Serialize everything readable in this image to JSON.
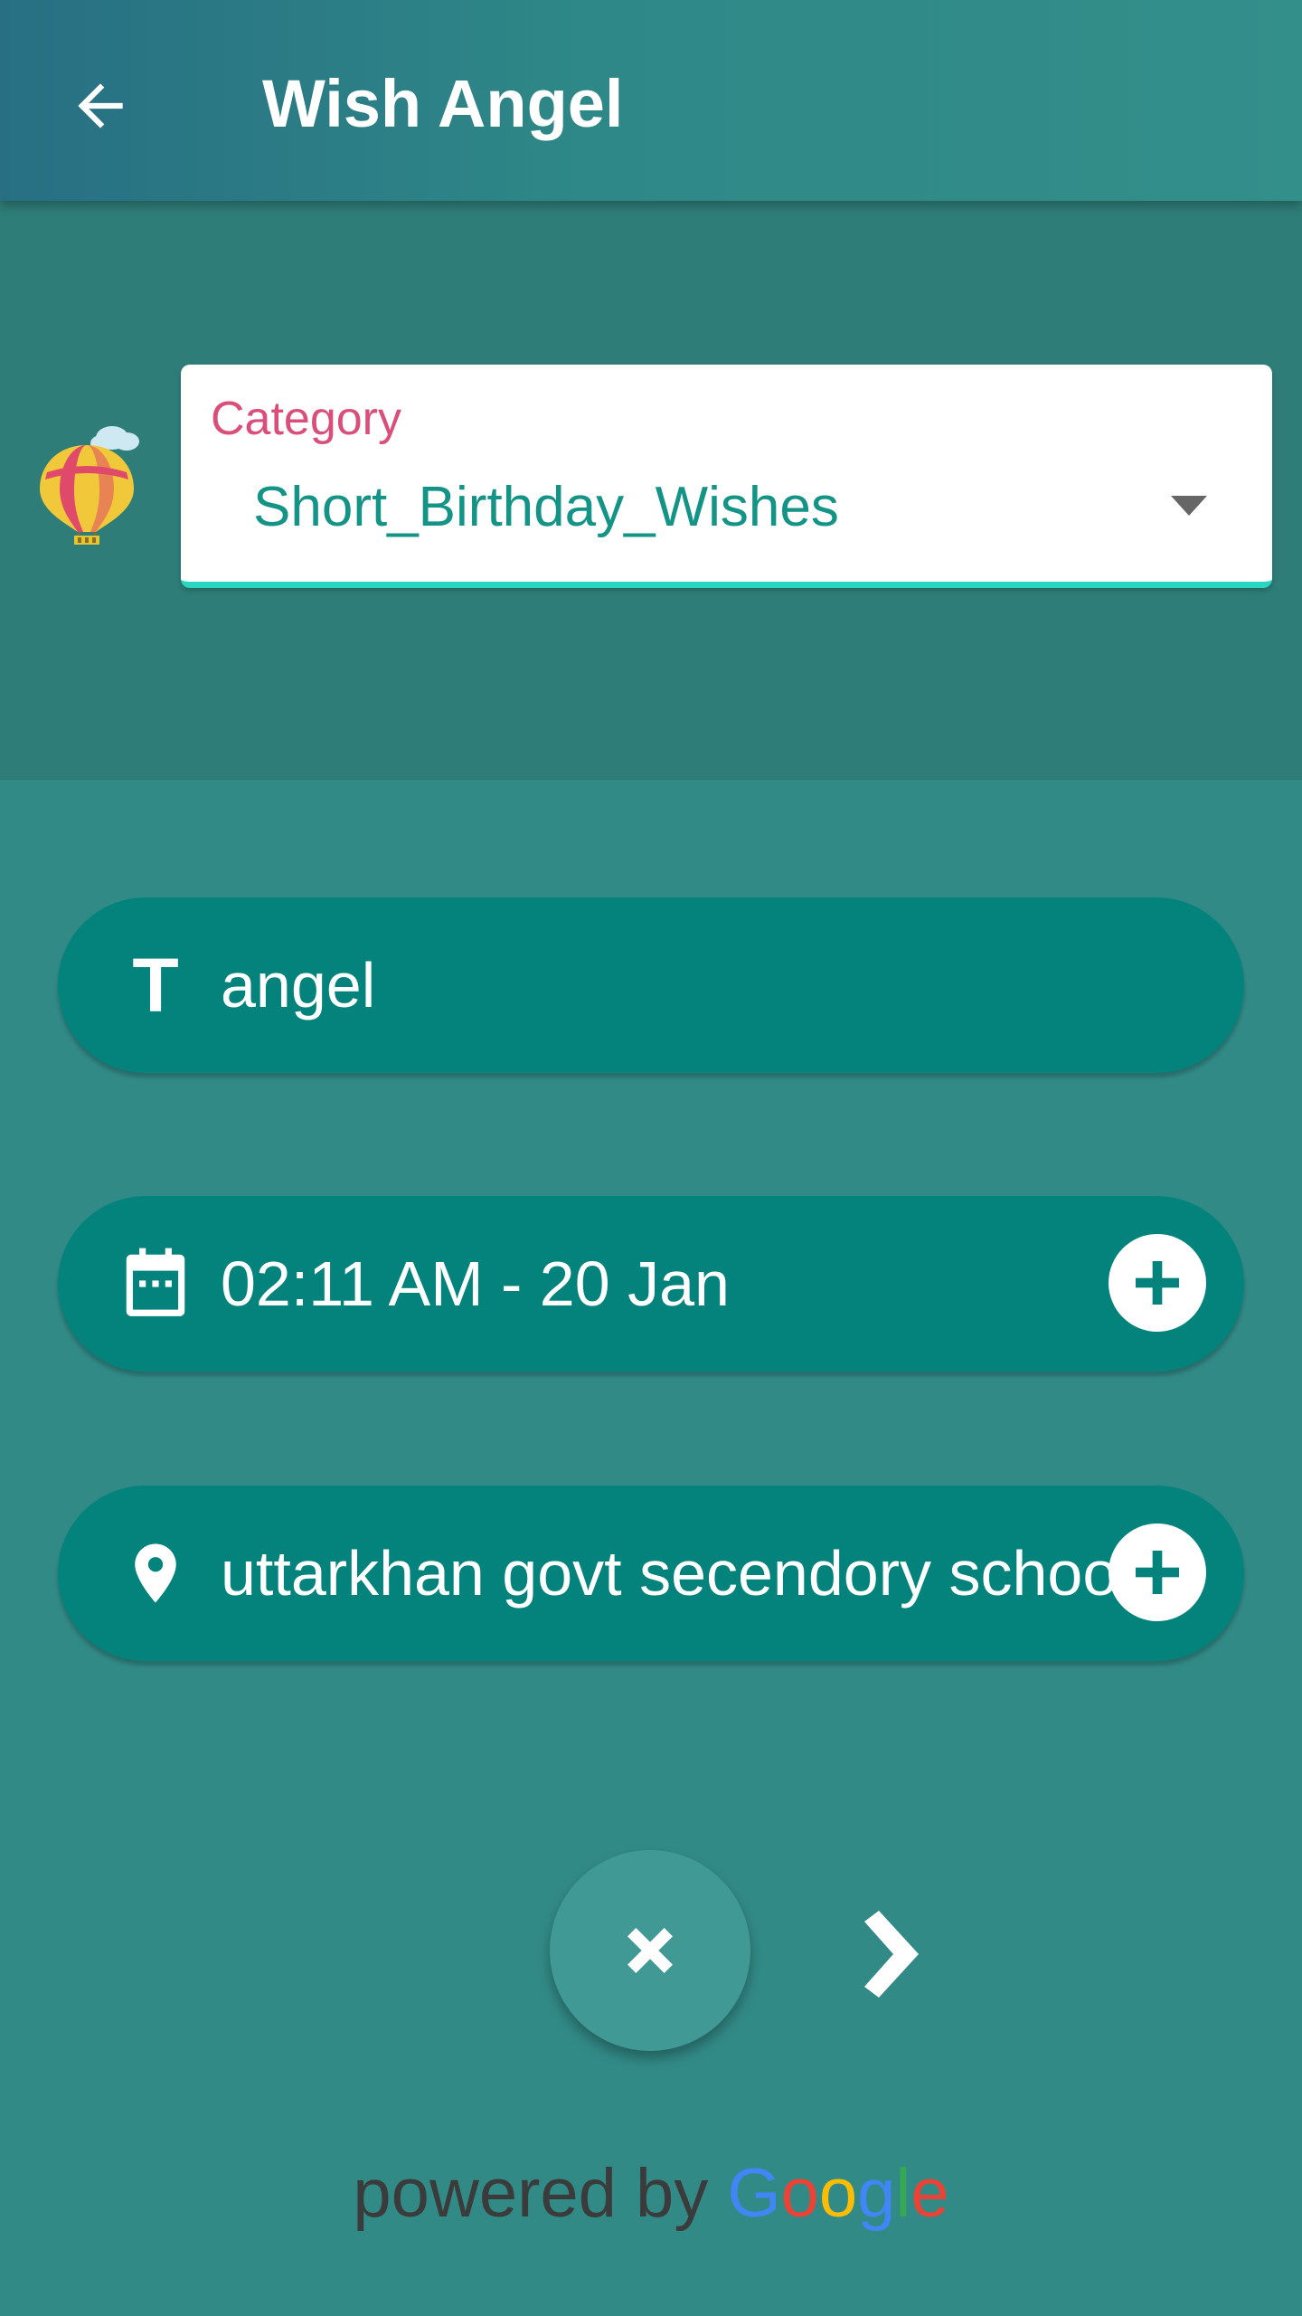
{
  "app_bar": {
    "title": "Wish Angel",
    "back_icon": "arrow-left-icon"
  },
  "category": {
    "label": "Category",
    "value": "Short_Birthday_Wishes",
    "dropdown_icon": "caret-down-icon",
    "logo_icon": "hot-air-balloon-icon"
  },
  "fields": {
    "title": {
      "icon": "text-icon",
      "icon_glyph": "T",
      "value": "angel"
    },
    "datetime": {
      "icon": "calendar-icon",
      "value": "02:11 AM - 20 Jan",
      "action_icon": "plus-icon"
    },
    "location": {
      "icon": "location-pin-icon",
      "value": "uttarkhan govt secendory school",
      "action_icon": "plus-icon"
    }
  },
  "actions": {
    "close_icon": "close-icon",
    "next_icon": "chevron-right-icon"
  },
  "attribution": {
    "prefix": "powered by",
    "brand_letters": [
      "G",
      "o",
      "o",
      "g",
      "l",
      "e"
    ]
  },
  "colors": {
    "background": "#328a87",
    "header_band": "#2f7d78",
    "pill": "#03837c",
    "category_label": "#d94f7a",
    "category_value": "#149486",
    "underline_accent": "#2bd6c0"
  }
}
